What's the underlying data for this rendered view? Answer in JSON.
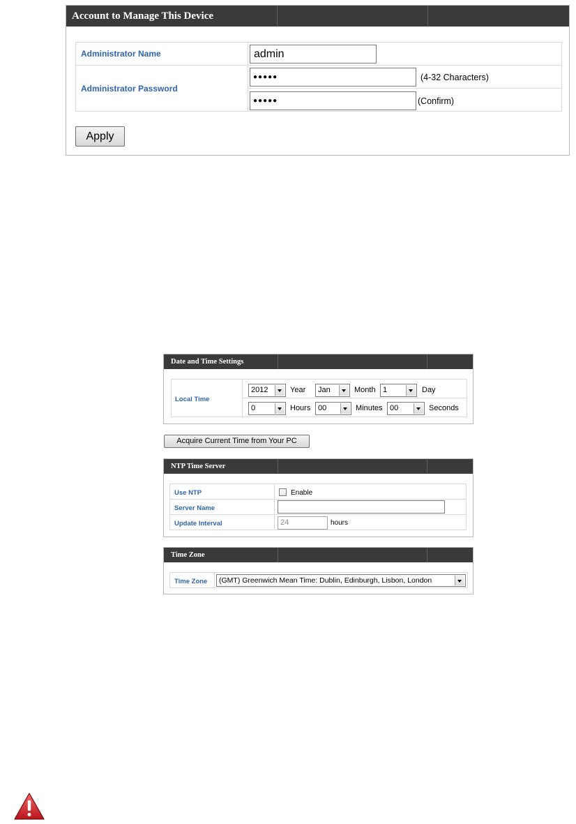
{
  "account": {
    "header": "Account to Manage This Device",
    "admin_name_label": "Administrator Name",
    "admin_name_value": "admin",
    "admin_password_label": "Administrator Password",
    "password_value": "●●●●●",
    "confirm_value": "●●●●●",
    "password_hint": "(4-32 Characters)",
    "confirm_hint": "(Confirm)",
    "apply_label": "Apply"
  },
  "datetime": {
    "header": "Date and Time Settings",
    "local_time_label": "Local Time",
    "year": "2012",
    "year_label": "Year",
    "month": "Jan",
    "month_label": "Month",
    "day": "1",
    "day_label": "Day",
    "hours": "0",
    "hours_label": "Hours",
    "minutes": "00",
    "minutes_label": "Minutes",
    "seconds": "00",
    "seconds_label": "Seconds",
    "acquire_label": "Acquire Current Time from Your PC"
  },
  "ntp": {
    "header": "NTP Time Server",
    "use_ntp_label": "Use NTP",
    "enable_label": "Enable",
    "enable_checked": false,
    "server_name_label": "Server Name",
    "server_name_value": "",
    "update_interval_label": "Update Interval",
    "update_interval_value": "24",
    "hours_unit": "hours"
  },
  "timezone": {
    "header": "Time Zone",
    "label": "Time Zone",
    "value": "(GMT) Greenwich Mean Time: Dublin, Edinburgh, Lisbon, London"
  },
  "icons": {
    "warning": "warning-icon"
  },
  "colors": {
    "header_bg": "#3a3a3a",
    "label_blue": "#2f64b1",
    "warning_red": "#d2222a"
  }
}
